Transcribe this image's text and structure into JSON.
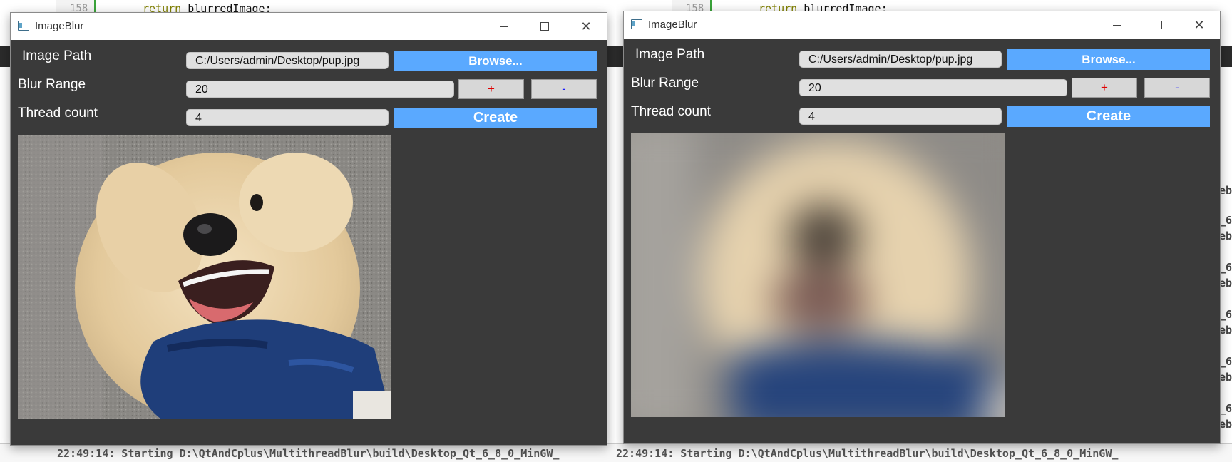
{
  "background_ide": {
    "line_number": "158",
    "code_keyword": "return",
    "code_rest": " blurredImage;",
    "bottom_log": "22:49:14: Starting D:\\QtAndCplus\\MultithreadBlur\\build\\Desktop_Qt_6_8_0_MinGW_",
    "right_fragments": [
      "eb",
      "_6",
      "eb",
      "_6",
      "eb",
      "_6",
      "eb",
      "_6",
      "eb",
      "_6",
      "eb"
    ]
  },
  "windows": [
    {
      "title": "ImageBlur",
      "image_path_label": "Image Path",
      "image_path_value": "C:/Users/admin/Desktop/pup.jpg",
      "browse_label": "Browse...",
      "blur_range_label": "Blur Range",
      "blur_range_value": "20",
      "plus_label": "+",
      "minus_label": "-",
      "thread_count_label": "Thread count",
      "thread_count_value": "4",
      "create_label": "Create",
      "image_state": "original"
    },
    {
      "title": "ImageBlur",
      "image_path_label": "Image Path",
      "image_path_value": "C:/Users/admin/Desktop/pup.jpg",
      "browse_label": "Browse...",
      "blur_range_label": "Blur Range",
      "blur_range_value": "20",
      "plus_label": "+",
      "minus_label": "-",
      "thread_count_label": "Thread count",
      "thread_count_value": "4",
      "create_label": "Create",
      "image_state": "blurred"
    }
  ],
  "colors": {
    "accent_button": "#5aa9ff",
    "window_background": "#3a3a3a",
    "plus_color": "#e00000",
    "minus_color": "#1a1aff"
  },
  "icons": [
    "app-icon",
    "minimize-icon",
    "maximize-icon",
    "close-icon"
  ]
}
